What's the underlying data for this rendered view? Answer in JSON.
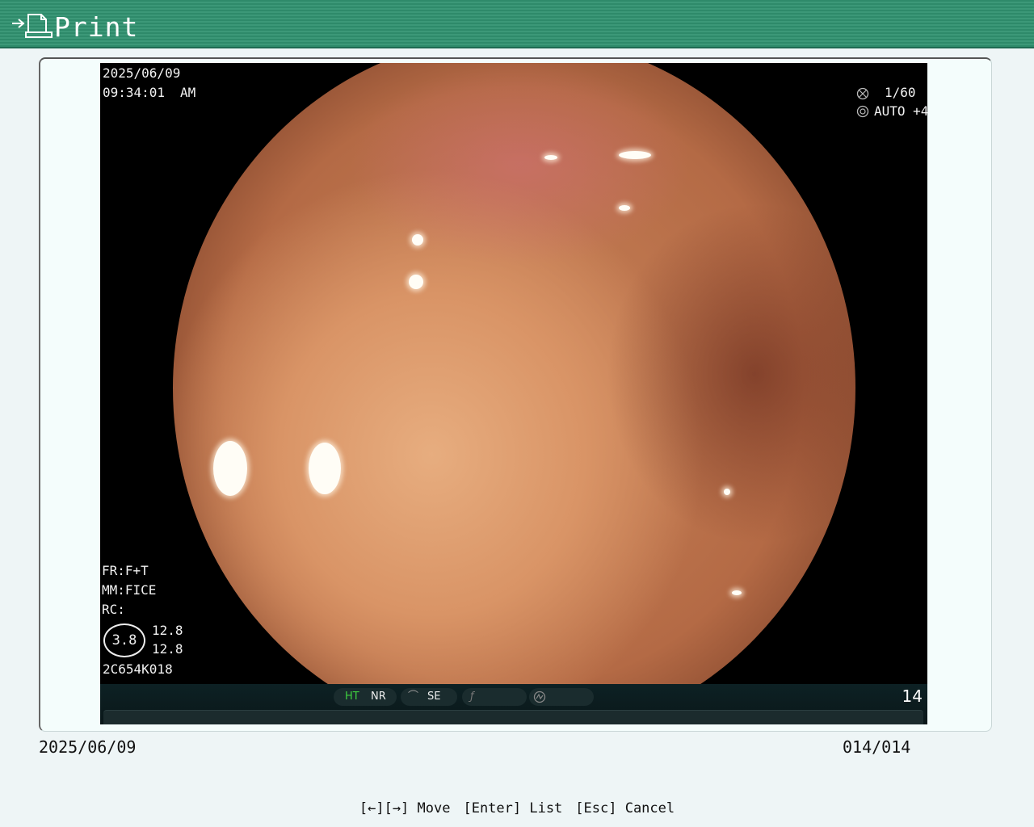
{
  "window": {
    "title": "Print",
    "title_icon": "print-document-icon",
    "colors": {
      "titlebar": "#2e8a6a",
      "background": "#eef5f6",
      "frame": "#f4fdfc"
    }
  },
  "image": {
    "date": "2025/06/09",
    "time": "09:34:01",
    "ampm": "AM",
    "shutter": "1/60",
    "iris": "AUTO +4",
    "fr": "FR:F+T",
    "mm": "MM:FICE",
    "rc": "RC:",
    "zoom": "3.8",
    "zoom_value_1": "12.8",
    "zoom_value_2": "12.8",
    "scope_id": "2C654K018",
    "strip": {
      "ht": "HT",
      "nr": "NR",
      "se": "SE",
      "frame_number": "14"
    }
  },
  "info": {
    "date": "2025/06/09",
    "count": "014/014"
  },
  "keyhints": {
    "move": "[←][→] Move",
    "list": "[Enter] List",
    "cancel": "[Esc] Cancel"
  }
}
